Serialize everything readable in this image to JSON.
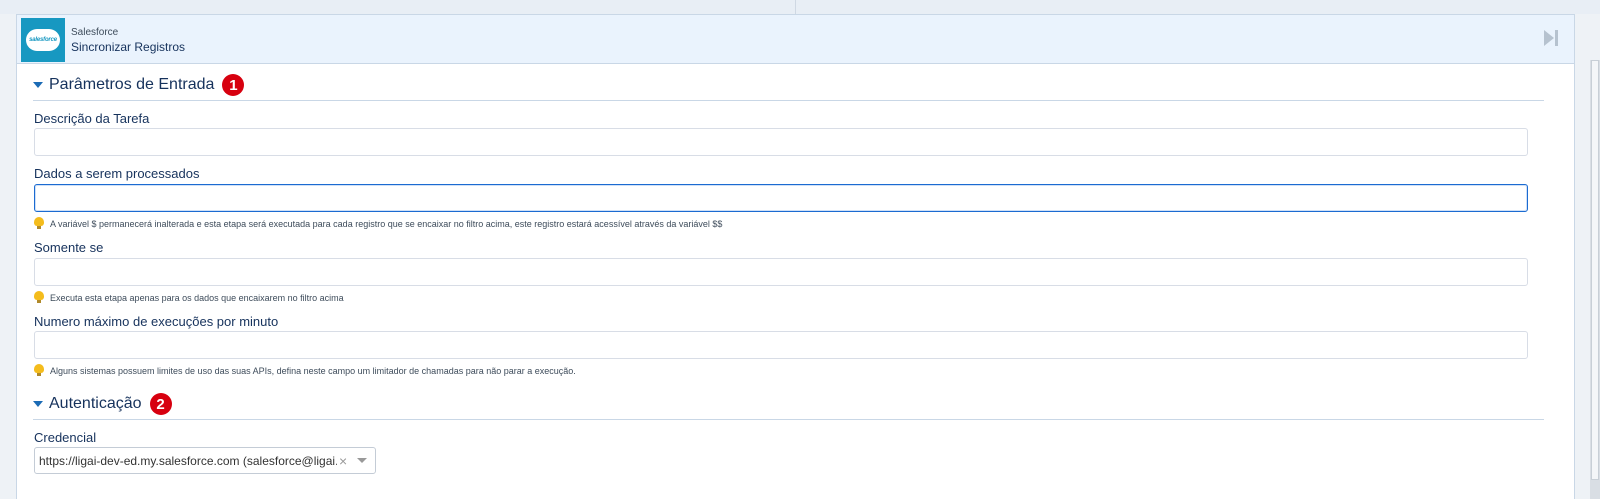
{
  "header": {
    "logo_text": "salesforce",
    "app_name": "Salesforce",
    "title": "Sincronizar Registros"
  },
  "sections": [
    {
      "title": "Parâmetros de Entrada",
      "badge": "1",
      "fields": [
        {
          "label": "Descrição da Tarefa",
          "value": "",
          "hint": ""
        },
        {
          "label": "Dados a serem processados",
          "value": "",
          "hint": "A variável $ permanecerá inalterada e esta etapa será executada para cada registro que se encaixar no filtro acima, este registro estará acessível através da variável $$"
        },
        {
          "label": "Somente se",
          "value": "",
          "hint": "Executa esta etapa apenas para os dados que encaixarem no filtro acima"
        },
        {
          "label": "Numero máximo de execuções por minuto",
          "value": "",
          "hint": "Alguns sistemas possuem limites de uso das suas APIs, defina neste campo um limitador de chamadas para não parar a execução."
        }
      ]
    },
    {
      "title": "Autenticação",
      "badge": "2",
      "fields": [
        {
          "label": "Credencial",
          "value": "https://ligai-dev-ed.my.salesforce.com (salesforce@ligai.co..."
        }
      ]
    }
  ],
  "icons": {
    "logo": "salesforce-cloud-icon",
    "header_action": "skip-forward-icon",
    "section_toggle": "caret-down-icon",
    "hint": "lightbulb-icon",
    "clear": "close-icon",
    "dropdown": "chevron-down-icon"
  },
  "colors": {
    "accent": "#1b6bd1",
    "badge": "#d7000f",
    "logo": "#1798c1",
    "header_bg": "#eaf3fd"
  }
}
